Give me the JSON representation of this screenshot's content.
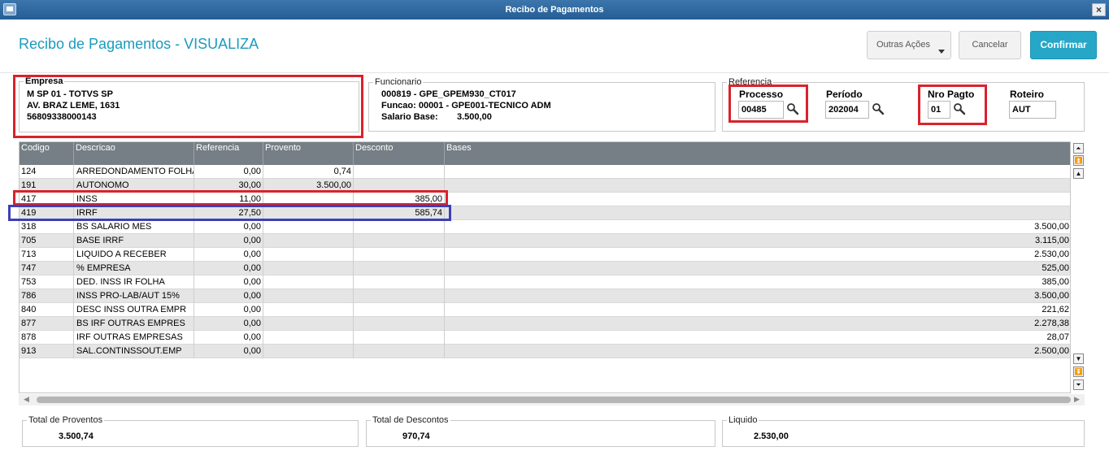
{
  "window": {
    "title": "Recibo de Pagamentos",
    "close_glyph": "×"
  },
  "header": {
    "title": "Recibo de Pagamentos - VISUALIZA",
    "outras_acoes": "Outras Ações",
    "cancelar": "Cancelar",
    "confirmar": "Confirmar"
  },
  "empresa": {
    "label": "Empresa",
    "line1": "M SP 01  - TOTVS SP",
    "line2": "AV. BRAZ LEME, 1631",
    "line3": "56809338000143"
  },
  "funcionario": {
    "label": "Funcionario",
    "line1": "000819 - GPE_GPEM930_CT017",
    "line2": "Funcao: 00001 - GPE001-TECNICO ADM",
    "salario_label": "Salario Base:",
    "salario_value": "3.500,00"
  },
  "referencia": {
    "label": "Referencia",
    "processo_label": "Processo",
    "processo_value": "00485",
    "periodo_label": "Período",
    "periodo_value": "202004",
    "nro_pagto_label": "Nro Pagto",
    "nro_pagto_value": "01",
    "roteiro_label": "Roteiro",
    "roteiro_value": "AUT"
  },
  "grid": {
    "columns": [
      "Codigo",
      "Descricao",
      "Referencia",
      "Provento",
      "Desconto",
      "Bases"
    ],
    "rows": [
      [
        "124",
        "ARREDONDAMENTO FOLHA",
        "0,00",
        "0,74",
        "",
        ""
      ],
      [
        "191",
        "AUTONOMO",
        "30,00",
        "3.500,00",
        "",
        ""
      ],
      [
        "417",
        "INSS",
        "11,00",
        "",
        "385,00",
        ""
      ],
      [
        "419",
        "IRRF",
        "27,50",
        "",
        "585,74",
        ""
      ],
      [
        "318",
        "BS SALARIO MES",
        "0,00",
        "",
        "",
        "3.500,00"
      ],
      [
        "705",
        "BASE IRRF",
        "0,00",
        "",
        "",
        "3.115,00"
      ],
      [
        "713",
        "LIQUIDO A RECEBER",
        "0,00",
        "",
        "",
        "2.530,00"
      ],
      [
        "747",
        "% EMPRESA",
        "0,00",
        "",
        "",
        "525,00"
      ],
      [
        "753",
        "DED. INSS IR FOLHA",
        "0,00",
        "",
        "",
        "385,00"
      ],
      [
        "786",
        "INSS PRO-LAB/AUT 15%",
        "0,00",
        "",
        "",
        "3.500,00"
      ],
      [
        "840",
        "DESC INSS OUTRA EMPR",
        "0,00",
        "",
        "",
        "221,62"
      ],
      [
        "877",
        "BS IRF OUTRAS EMPRES",
        "0,00",
        "",
        "",
        "2.278,38"
      ],
      [
        "878",
        "IRF OUTRAS EMPRESAS",
        "0,00",
        "",
        "",
        "28,07"
      ],
      [
        "913",
        "SAL.CONTINSSOUT.EMP",
        "0,00",
        "",
        "",
        "2.500,00"
      ]
    ]
  },
  "totals": {
    "proventos_label": "Total de Proventos",
    "proventos_value": "3.500,74",
    "descontos_label": "Total de Descontos",
    "descontos_value": "970,74",
    "liquido_label": "Liquido",
    "liquido_value": "2.530,00"
  },
  "colors": {
    "title_bar": "#2f6aa3",
    "accent": "#1a9bbd",
    "confirm": "#26a7c8",
    "grid_header": "#757f85",
    "highlight_red": "#d9222d",
    "highlight_blue": "#3c40b6"
  },
  "icons": {
    "search": "magnifier-icon",
    "app": "window-icon"
  }
}
